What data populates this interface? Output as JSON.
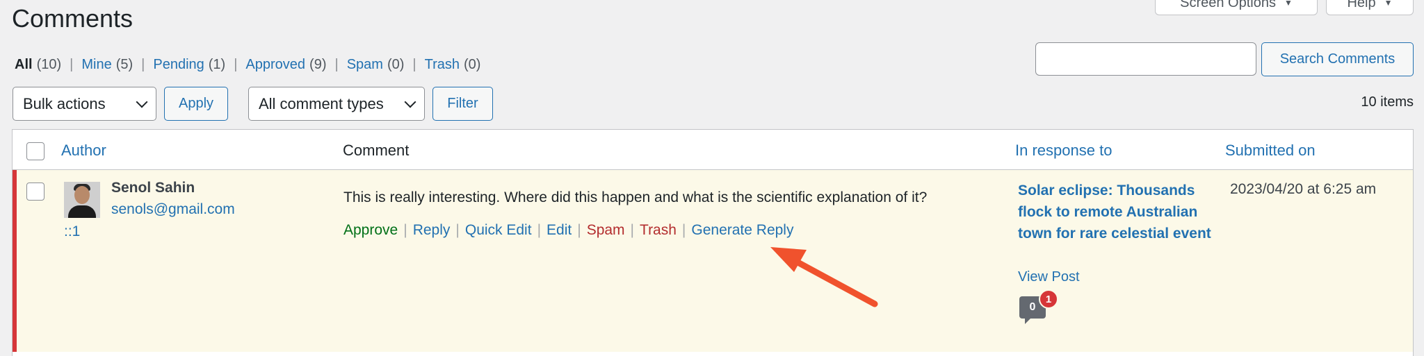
{
  "page": {
    "title": "Comments"
  },
  "top_tabs": {
    "screen_options": "Screen Options",
    "help": "Help"
  },
  "filters": [
    {
      "label": "All",
      "count": "(10)",
      "current": true
    },
    {
      "label": "Mine",
      "count": "(5)"
    },
    {
      "label": "Pending",
      "count": "(1)"
    },
    {
      "label": "Approved",
      "count": "(9)"
    },
    {
      "label": "Spam",
      "count": "(0)"
    },
    {
      "label": "Trash",
      "count": "(0)"
    }
  ],
  "search": {
    "value": "",
    "button": "Search Comments"
  },
  "toolbar": {
    "bulk_actions": "Bulk actions",
    "apply": "Apply",
    "comment_types": "All comment types",
    "filter": "Filter",
    "items_count": "10 items"
  },
  "table": {
    "columns": {
      "author": "Author",
      "comment": "Comment",
      "in_response_to": "In response to",
      "submitted_on": "Submitted on"
    },
    "rows": [
      {
        "author_name": "Senol Sahin",
        "author_email": "senols@gmail.com",
        "author_ip": "::1",
        "comment": "This is really interesting. Where did this happen and what is the scientific explanation of it?",
        "actions": {
          "approve": "Approve",
          "reply": "Reply",
          "quick_edit": "Quick Edit",
          "edit": "Edit",
          "spam": "Spam",
          "trash": "Trash",
          "generate_reply": "Generate Reply"
        },
        "post_title": "Solar eclipse: Thousands flock to remote Australian town for rare celestial event",
        "view_post": "View Post",
        "approved_count": "0",
        "pending_count": "1",
        "submitted": "2023/04/20 at 6:25 am",
        "status_color": "#d63638"
      }
    ]
  },
  "colors": {
    "link": "#2271b1",
    "approve": "#007017",
    "danger": "#b32d2e",
    "annotation_arrow": "#f0522d",
    "unapproved_row_bg": "#fcf9e8"
  }
}
